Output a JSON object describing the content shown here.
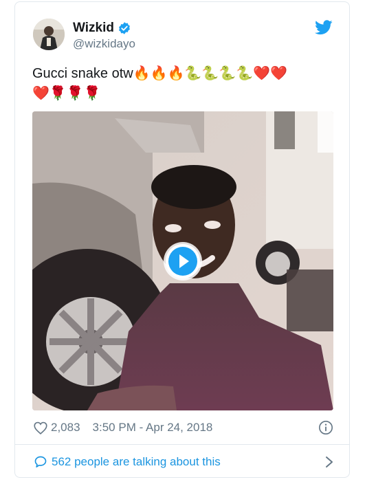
{
  "tweet": {
    "author_name": "Wizkid",
    "author_handle": "@wizkidayo",
    "text_line1": "Gucci snake otw🔥🔥🔥🐍🐍🐍🐍❤️❤️",
    "text_line2": "❤️🌹🌹🌹",
    "likes": "2,083",
    "timestamp": "3:50 PM - Apr 24, 2018",
    "talking_label": "562 people are talking about this"
  },
  "icons": {
    "verified": "verified-badge-icon",
    "logo": "twitter-bird-icon",
    "like": "heart-outline-icon",
    "info": "info-icon",
    "reply": "speech-bubble-icon",
    "play": "play-icon",
    "chevron": "chevron-right-icon"
  },
  "colors": {
    "brand": "#1da1f2",
    "link": "#1b95e0",
    "secondary_text": "#657786",
    "border": "#e1e8ed"
  }
}
